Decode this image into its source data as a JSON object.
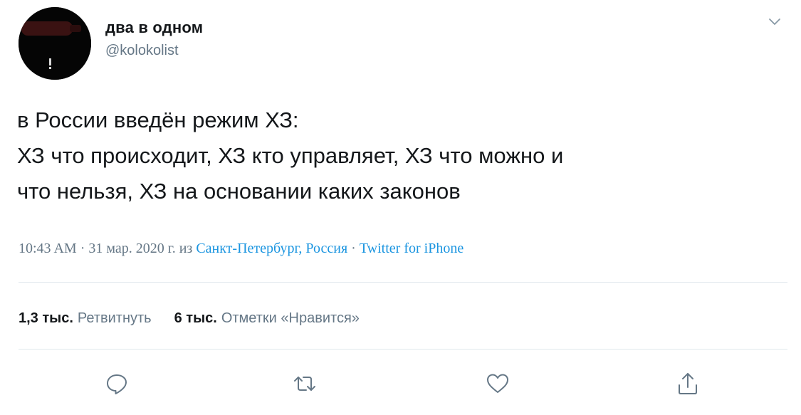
{
  "author": {
    "name": "два в одном",
    "handle": "@kolokolist"
  },
  "tweet": {
    "lines": [
      "в России введён режим ХЗ:",
      "ХЗ что происходит, ХЗ кто управляет, ХЗ что можно и",
      "что нельзя, ХЗ на основании каких законов"
    ]
  },
  "meta": {
    "time": "10:43 AM",
    "separator": " · ",
    "date": "31 мар. 2020 г.",
    "from": " из ",
    "location": "Санкт-Петербург, Россия",
    "source": "Twitter for iPhone"
  },
  "stats": {
    "retweets_count": "1,3 тыс.",
    "retweets_label": "Ретвитнуть",
    "likes_count": "6 тыс.",
    "likes_label": "Отметки «Нравится»"
  },
  "icons": {
    "menu": "chevron-down-icon",
    "reply": "reply-icon",
    "retweet": "retweet-icon",
    "like": "heart-icon",
    "share": "share-icon"
  },
  "colors": {
    "text": "#14171a",
    "secondary": "#657786",
    "link": "#1b95e0",
    "divider": "#e1e8ed"
  }
}
